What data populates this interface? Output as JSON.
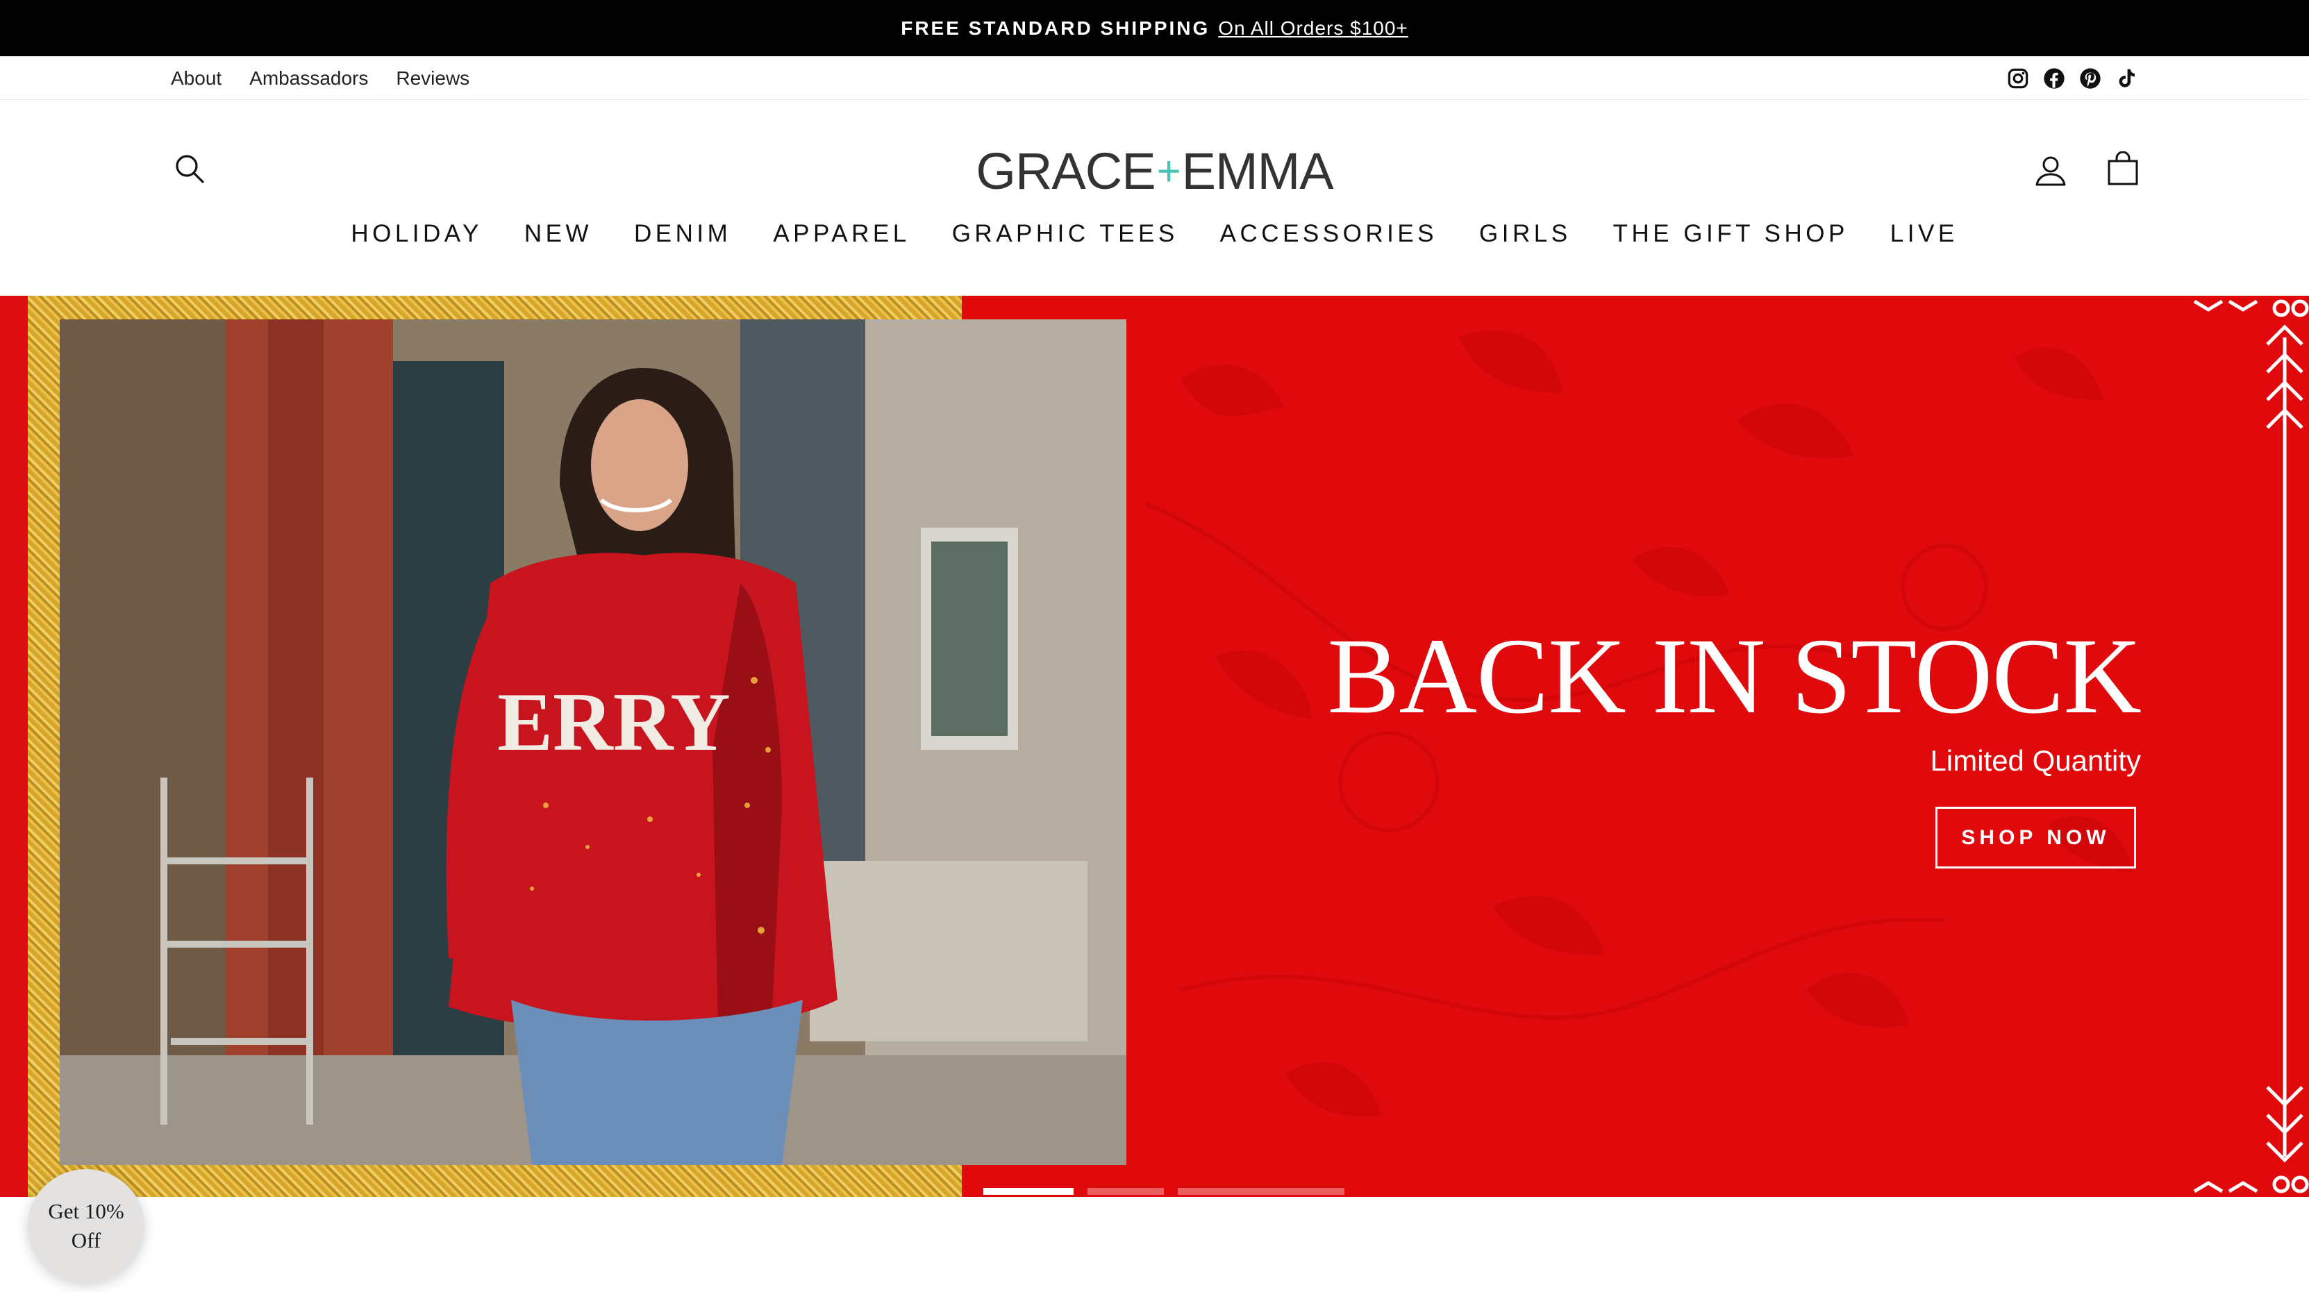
{
  "announcement": {
    "bold": "FREE STANDARD SHIPPING",
    "link": "On All Orders $100+"
  },
  "utility": {
    "links": [
      "About",
      "Ambassadors",
      "Reviews"
    ],
    "social": [
      "instagram-icon",
      "facebook-icon",
      "pinterest-icon",
      "tiktok-icon"
    ]
  },
  "header": {
    "logo_left": "GRACE",
    "logo_plus": "+",
    "logo_right": "EMMA",
    "icons": [
      "search-icon",
      "account-icon",
      "cart-icon"
    ]
  },
  "nav": [
    "HOLIDAY",
    "NEW",
    "DENIM",
    "APPAREL",
    "GRAPHIC TEES",
    "ACCESSORIES",
    "GIRLS",
    "THE GIFT SHOP",
    "LIVE"
  ],
  "hero": {
    "title": "BACK IN STOCK",
    "subtitle": "Limited Quantity",
    "cta": "SHOP NOW",
    "sweater_text": "ERRY",
    "background_color": "#e00a0c",
    "slides": 3,
    "active_slide": 1
  },
  "discount_popup": {
    "line1": "Get 10%",
    "line2": "Off"
  }
}
